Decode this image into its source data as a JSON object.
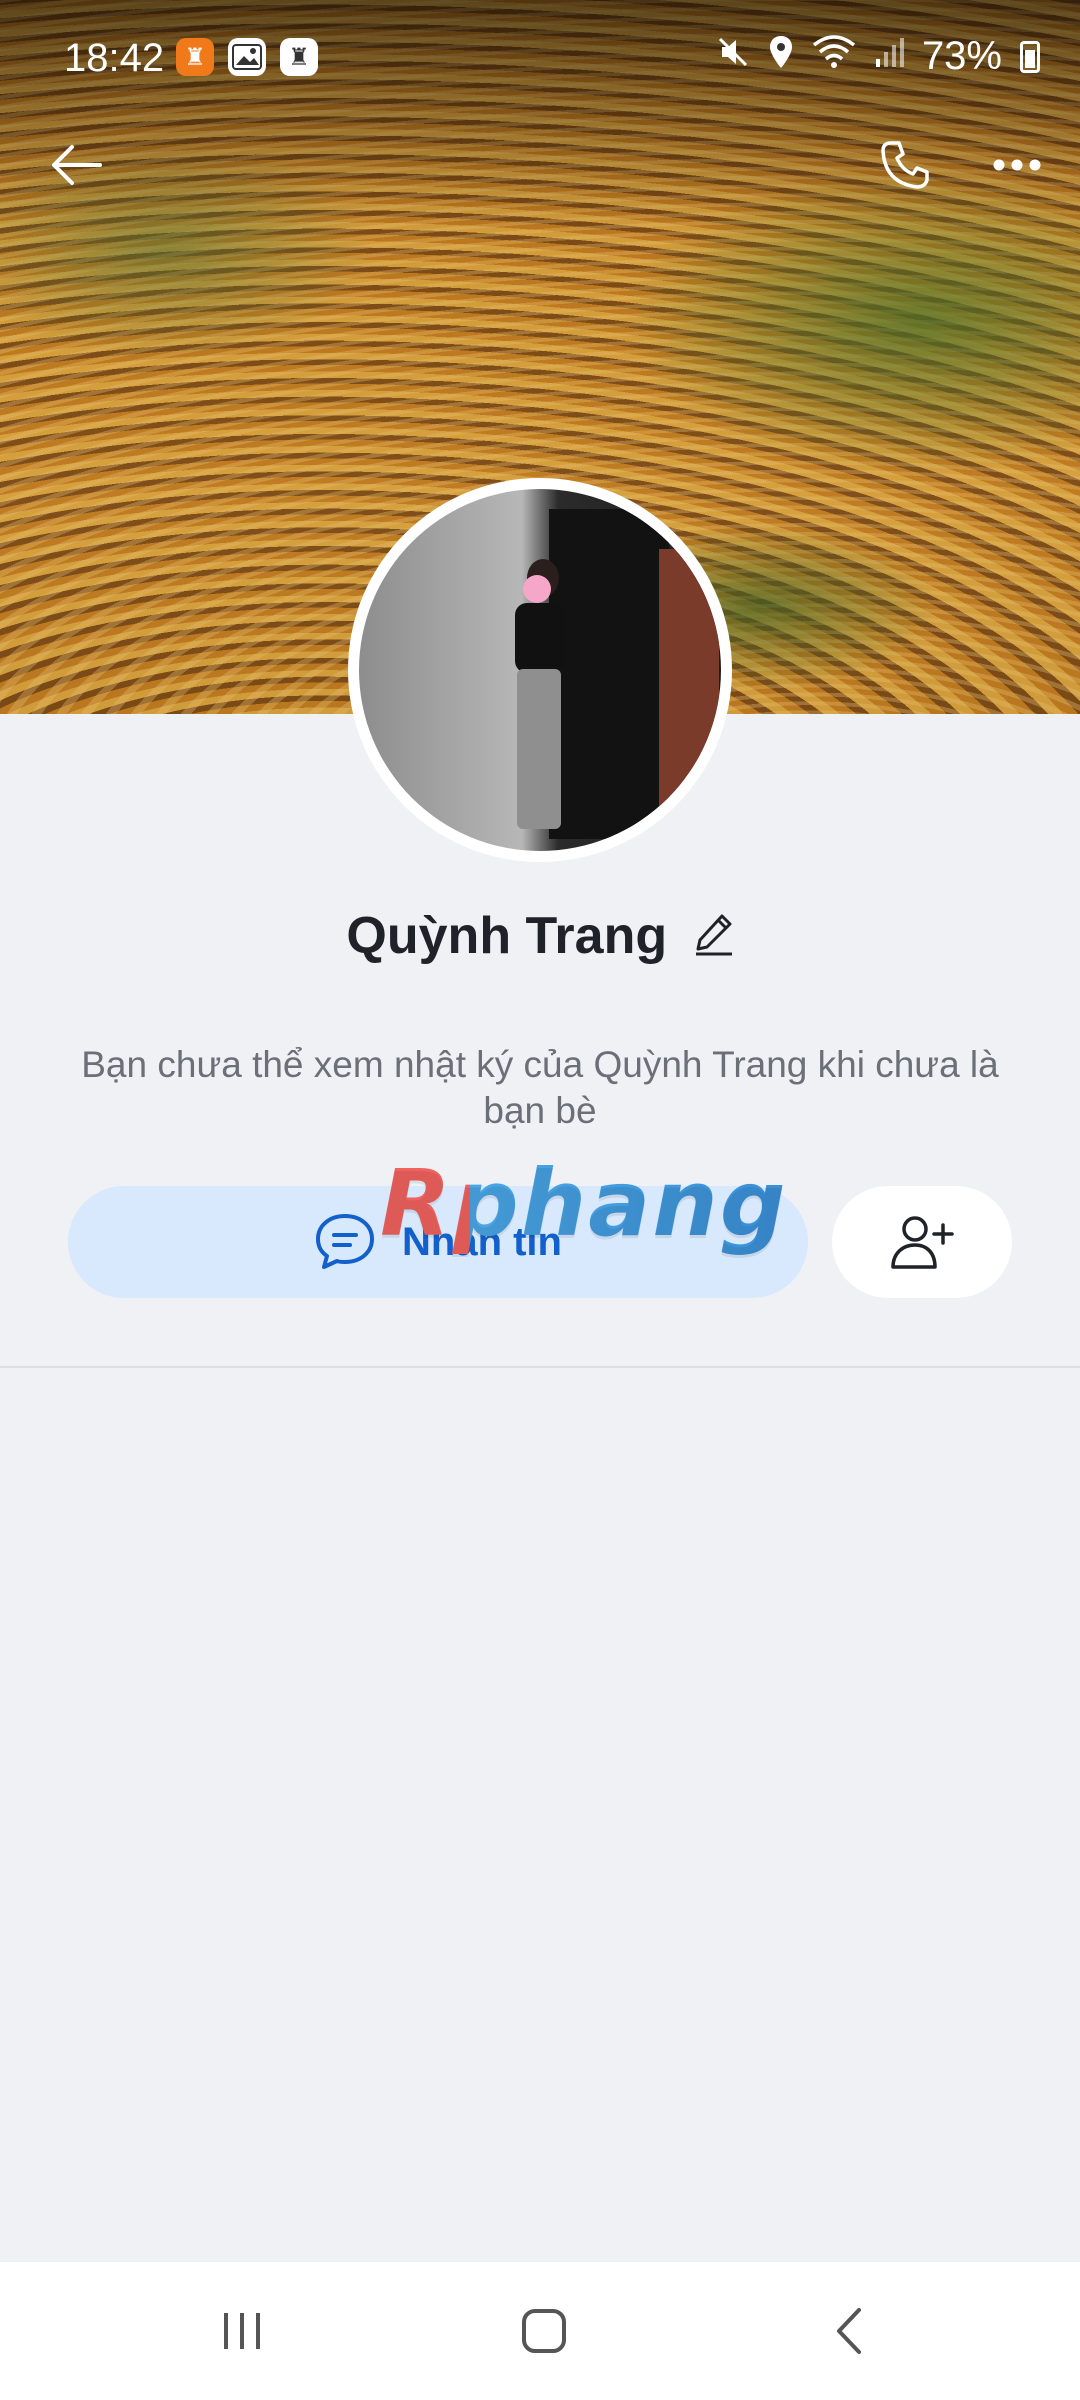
{
  "status_bar": {
    "time": "18:42",
    "battery": "73%",
    "left_icons": [
      "notification-app-icon",
      "gallery-icon",
      "notification-app-icon"
    ],
    "right_icons": [
      "mute-icon",
      "location-icon",
      "wifi-icon",
      "signal-icon",
      "battery-icon"
    ]
  },
  "profile": {
    "name": "Quỳnh Trang",
    "privacy_note": "Bạn chưa thể xem nhật ký của Quỳnh Trang khi chưa là bạn bè"
  },
  "actions": {
    "message_label": "Nhắn tin"
  },
  "watermark": "Rphang",
  "colors": {
    "background": "#eff1f5",
    "message_button_bg": "#d8e8fd",
    "message_button_text": "#1260cc",
    "name_text": "#1f2229",
    "note_text": "#6b6f77"
  }
}
